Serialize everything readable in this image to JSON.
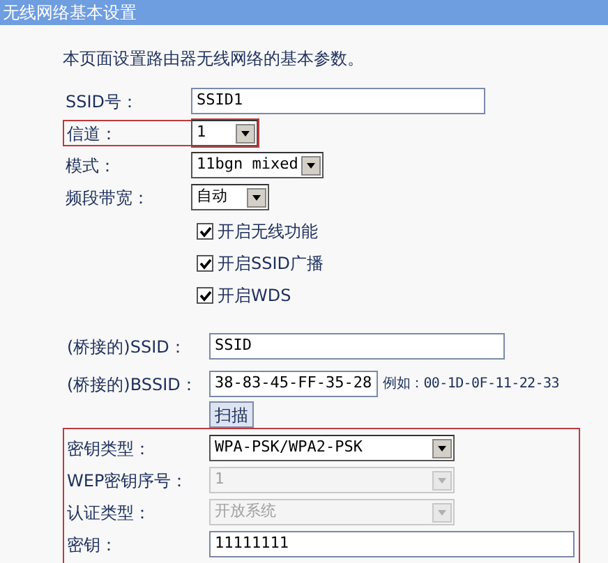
{
  "title": "无线网络基本设置",
  "intro": "本页面设置路由器无线网络的基本参数。",
  "basic_fields": [
    {
      "kind": "text",
      "label": "SSID号：",
      "value": "SSID1",
      "highlighted": false
    },
    {
      "kind": "select",
      "label": "信道：",
      "value": "1",
      "highlighted": true
    },
    {
      "kind": "select",
      "label": "模式：",
      "value": "11bgn mixed",
      "highlighted": false
    },
    {
      "kind": "select",
      "label": "频段带宽：",
      "value": "自动",
      "highlighted": false
    }
  ],
  "options": [
    {
      "label": "开启无线功能",
      "checked": true
    },
    {
      "label": "开启SSID广播",
      "checked": true
    },
    {
      "label": "开启WDS",
      "checked": true
    }
  ],
  "bridge": {
    "ssid_label": "(桥接的)SSID：",
    "ssid_value": "SSID",
    "bssid_label": "(桥接的)BSSID：",
    "bssid_value": "38-83-45-FF-35-28",
    "example": "例如：00-1D-0F-11-22-33",
    "scan_button": "扫描"
  },
  "security": {
    "highlighted": true,
    "fields": [
      {
        "kind": "select",
        "label": "密钥类型：",
        "value": "WPA-PSK/WPA2-PSK",
        "disabled": false
      },
      {
        "kind": "select",
        "label": "WEP密钥序号：",
        "value": "1",
        "disabled": true
      },
      {
        "kind": "select",
        "label": "认证类型：",
        "value": "开放系统",
        "disabled": true
      },
      {
        "kind": "text",
        "label": "密钥：",
        "value": "11111111",
        "disabled": false
      }
    ]
  }
}
